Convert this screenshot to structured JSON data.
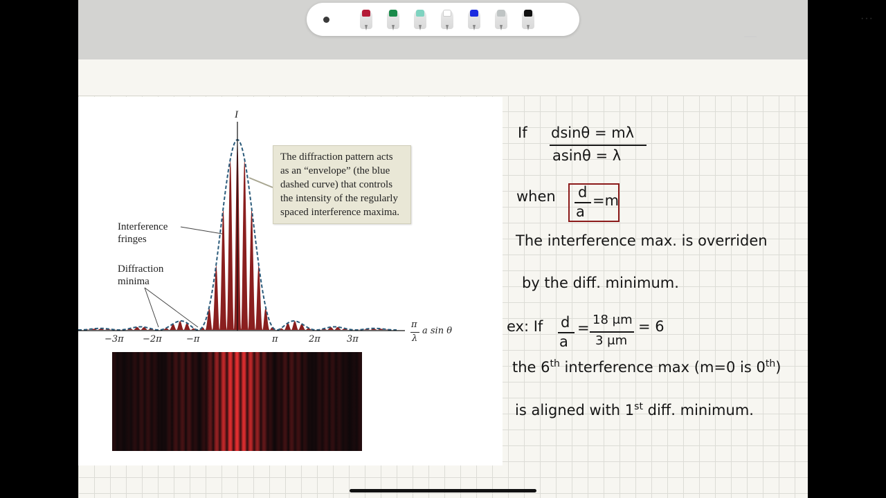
{
  "toolbar": {
    "more_label": "···",
    "tools": [
      {
        "name": "red-marker",
        "color": "#b41a36"
      },
      {
        "name": "green-marker",
        "color": "#1a8a4a"
      },
      {
        "name": "teal-marker",
        "color": "#7fd3c0"
      },
      {
        "name": "white-marker",
        "color": "#ffffff"
      },
      {
        "name": "blue-marker",
        "color": "#1a2be0"
      },
      {
        "name": "gray-marker",
        "color": "#bfc4c4"
      },
      {
        "name": "black-marker",
        "color": "#111111"
      }
    ]
  },
  "figure": {
    "y_label": "I",
    "x_label_num": "π",
    "x_label_den": "λ",
    "x_label_rest": "a sin θ",
    "ticks": [
      "−3π",
      "−2π",
      "−π",
      "π",
      "2π",
      "3π"
    ],
    "callout": "The diffraction pattern acts as an “envelope” (the blue dashed curve) that controls the intensity of the regularly spaced interference maxima.",
    "label_fringes_1": "Interference",
    "label_fringes_2": "fringes",
    "label_minima_1": "Diffraction",
    "label_minima_2": "minima",
    "colors": {
      "fringe": "#8a1f1f",
      "envelope": "#2a5a7a"
    }
  },
  "notes": {
    "line1_if": "If",
    "line1_num": "dsinθ = mλ",
    "line1_den": "asinθ = λ",
    "line2_when": "when",
    "line2_box_num": "d",
    "line2_box_den": "a",
    "line2_box_rest": "=m",
    "line3": "The interference max. is overriden",
    "line4": "by the diff. minimum.",
    "line5_prefix": "ex: If",
    "line5_frac1_num": "d",
    "line5_frac1_den": "a",
    "line5_eq": "=",
    "line5_frac2_num": "18 μm",
    "line5_frac2_den": "3 μm",
    "line5_result": "= 6",
    "line6_a": "the 6",
    "line6_sup": "th",
    "line6_b": " interference max (m=0 is 0",
    "line6_sup2": "th",
    "line6_c": ")",
    "line7_a": "is aligned with 1",
    "line7_sup": "st",
    "line7_b": " diff. minimum."
  }
}
